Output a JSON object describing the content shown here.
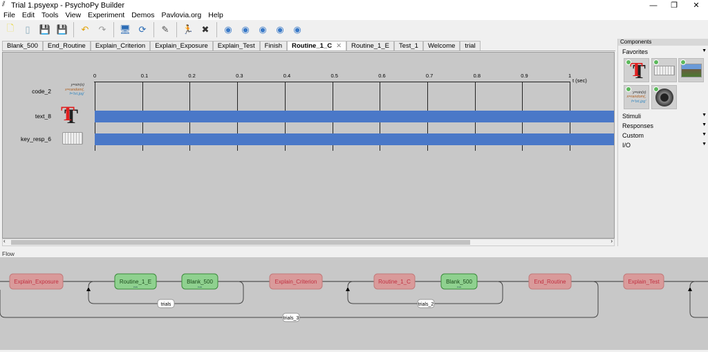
{
  "window": {
    "title": "Trial 1.psyexp - PsychoPy Builder",
    "minimize": "—",
    "maximize": "❐",
    "close": "✕"
  },
  "menu": [
    "File",
    "Edit",
    "Tools",
    "View",
    "Experiment",
    "Demos",
    "Pavlovia.org",
    "Help"
  ],
  "toolbar": [
    {
      "icon": "new-file-icon",
      "glyph": "🗋",
      "color": "#e8d84a"
    },
    {
      "icon": "open-icon",
      "glyph": "▯",
      "color": "#8ab"
    },
    {
      "icon": "save-icon",
      "glyph": "💾",
      "color": "#333"
    },
    {
      "icon": "save-as-icon",
      "glyph": "💾",
      "color": "#555"
    },
    {
      "icon": "undo-icon",
      "glyph": "↶",
      "color": "#e0a000"
    },
    {
      "icon": "redo-icon",
      "glyph": "↷",
      "color": "#999"
    },
    {
      "icon": "monitor-center-icon",
      "glyph": "🖥",
      "color": "#2a6bb5"
    },
    {
      "icon": "experiment-settings-icon",
      "glyph": "⟳",
      "color": "#2a6bb5"
    },
    {
      "icon": "compile-script-icon",
      "glyph": "✎",
      "color": "#555"
    },
    {
      "icon": "run-icon",
      "glyph": "🏃",
      "color": "#2a9d2a"
    },
    {
      "icon": "stop-icon",
      "glyph": "✖",
      "color": "#333"
    },
    {
      "icon": "pavlovia-sync-icon",
      "glyph": "◉",
      "color": "#3a7ac8"
    },
    {
      "icon": "pavlovia-search-icon",
      "glyph": "◉",
      "color": "#3a7ac8"
    },
    {
      "icon": "pavlovia-login-icon",
      "glyph": "◉",
      "color": "#3a7ac8"
    },
    {
      "icon": "pavlovia-user-icon",
      "glyph": "◉",
      "color": "#3a7ac8"
    },
    {
      "icon": "pavlovia-info-icon",
      "glyph": "◉",
      "color": "#3a7ac8"
    }
  ],
  "tabs": [
    "Blank_500",
    "End_Routine",
    "Explain_Criterion",
    "Explain_Exposure",
    "Explain_Test",
    "Finish",
    "Routine_1_C",
    "Routine_1_E",
    "Test_1",
    "Welcome",
    "trial"
  ],
  "active_tab": "Routine_1_C",
  "tab_close": "✕",
  "timeline": {
    "ticks": [
      "0",
      "0.1",
      "0.2",
      "0.3",
      "0.4",
      "0.5",
      "0.6",
      "0.7",
      "0.8",
      "0.9",
      "1"
    ],
    "unit": "t (sec)",
    "components": [
      {
        "name": "code_2",
        "code": [
          "y=sin(x)",
          "x=random(,",
          "f='txt.jpg'"
        ],
        "has_bar": false
      },
      {
        "name": "text_8",
        "has_bar": true
      },
      {
        "name": "key_resp_6",
        "has_bar": true
      }
    ],
    "bar_color": "#4a78c8"
  },
  "components_panel": {
    "title": "Components",
    "categories": [
      "Favorites",
      "Stimuli",
      "Responses",
      "Custom",
      "I/O"
    ],
    "arrow": "▼",
    "favorites": [
      "text-component",
      "keyboard-component",
      "image-component",
      "code-component",
      "sound-component"
    ],
    "code_icon": [
      "y=sin(x)",
      "x=random(,",
      "f='txt.jpg'"
    ]
  },
  "flow": {
    "label": "Flow",
    "routines": [
      {
        "name": "Explain_Exposure",
        "color": "red"
      },
      {
        "name": "Routine_1_E",
        "color": "green",
        "sub": "trials"
      },
      {
        "name": "Blank_500",
        "color": "green",
        "sub": "trials"
      },
      {
        "name": "Explain_Criterion",
        "color": "red"
      },
      {
        "name": "Routine_1_C",
        "color": "red"
      },
      {
        "name": "Blank_500",
        "color": "green",
        "sub": "trials"
      },
      {
        "name": "End_Routine",
        "color": "red"
      },
      {
        "name": "Explain_Test",
        "color": "red"
      }
    ],
    "loops": [
      "trials",
      "trials_2",
      "trials_3"
    ]
  }
}
